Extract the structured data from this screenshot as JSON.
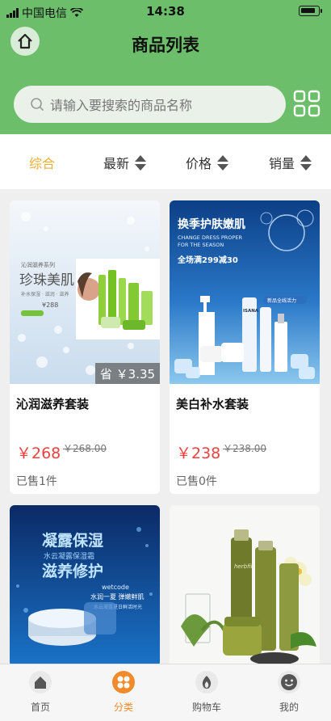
{
  "status_bar": {
    "carrier": "中国电信",
    "time": "14:38"
  },
  "header": {
    "title": "商品列表"
  },
  "search": {
    "placeholder": "请输入要搜索的商品名称"
  },
  "sort": {
    "items": [
      {
        "label": "综合",
        "active": true
      },
      {
        "label": "最新"
      },
      {
        "label": "价格"
      },
      {
        "label": "销量"
      }
    ]
  },
  "products": [
    {
      "name": "沁润滋养套装",
      "price": "￥268",
      "original_price": "￥268.00",
      "sold": "已售1件",
      "save_badge": "省 ￥3.35",
      "image_text": {
        "series": "沁润滋养系列",
        "brand": "珍珠美肌",
        "sub": "补水保湿 · 滋润 · 滋养",
        "price": "¥288"
      }
    },
    {
      "name": "美白补水套装",
      "price": "￥238",
      "original_price": "￥238.00",
      "sold": "已售0件",
      "image_text": {
        "headline": "换季护肤嫩肌",
        "en1": "CHANGE DRESS PROPER",
        "en2": "FOR THE SEASON",
        "promo": "全场满299减30",
        "tag": "新品全线活力",
        "brand": "ISANA"
      }
    },
    {
      "name": "",
      "image_text": {
        "line1": "凝露保湿",
        "line2": "水云凝露保湿霜",
        "line3": "滋养修护",
        "brand": "wetcode",
        "line4": "水润一夏 弹嫩鲜肌",
        "line5": "水云凝露夏日鲜活时光"
      }
    },
    {
      "name": "",
      "image_text": {
        "brand": "herbfill"
      }
    }
  ],
  "tabbar": {
    "items": [
      {
        "label": "首页"
      },
      {
        "label": "分类",
        "active": true
      },
      {
        "label": "购物车"
      },
      {
        "label": "我的"
      }
    ]
  },
  "colors": {
    "header_green": "#6cbe6a",
    "accent_orange": "#f08a2a",
    "active_sort": "#f0ad35",
    "price_red": "#ef4040"
  }
}
